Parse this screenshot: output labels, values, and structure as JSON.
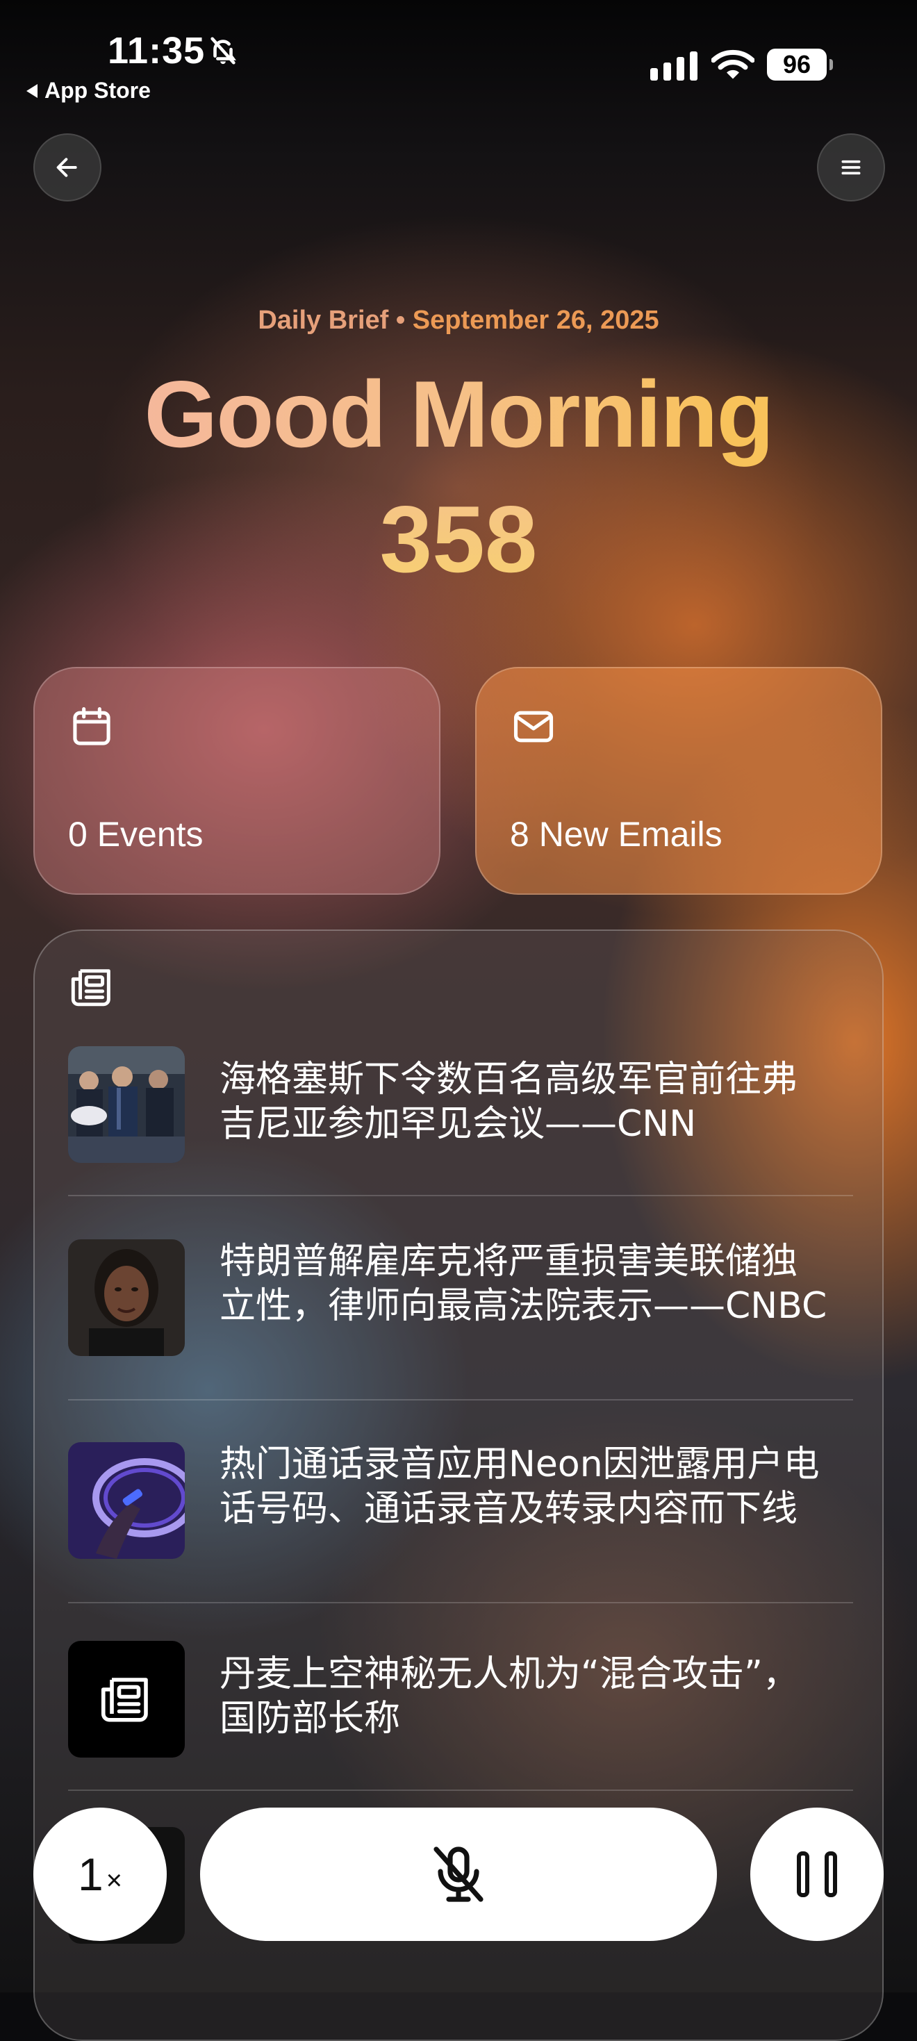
{
  "status_bar": {
    "time": "11:35",
    "battery": "96",
    "back_app": "App Store"
  },
  "header": {
    "brief_label": "Daily Brief",
    "separator": "•",
    "date": "September 26, 2025",
    "greeting": "Good Morning",
    "number": "358"
  },
  "cards": {
    "events": {
      "label": "0 Events",
      "icon": "calendar-icon"
    },
    "emails": {
      "label": "8 New Emails",
      "icon": "mail-icon"
    }
  },
  "news": {
    "icon": "newspaper-icon",
    "items": [
      {
        "headline": "海格塞斯下令数百名高级军官前往弗吉尼亚参加罕见会议——CNN",
        "thumb": "photo-military-officers"
      },
      {
        "headline": "特朗普解雇库克将严重损害美联储独立性，律师向最高法院表示——CNBC",
        "thumb": "photo-portrait"
      },
      {
        "headline": "热门通话录音应用Neon因泄露用户电话号码、通话录音及转录内容而下线",
        "thumb": "photo-neon-light"
      },
      {
        "headline": "丹麦上空神秘无人机为“混合攻击”，国防部长称",
        "thumb": "newspaper-icon"
      }
    ]
  },
  "controls": {
    "speed": "1",
    "speed_suffix": "×",
    "mic": "mic-off-icon",
    "pause": "pause-icon"
  },
  "colors": {
    "accent_orange": "#e89a62",
    "greeting_gradient_start": "#f4b4a4",
    "greeting_gradient_end": "#f8c25a"
  }
}
